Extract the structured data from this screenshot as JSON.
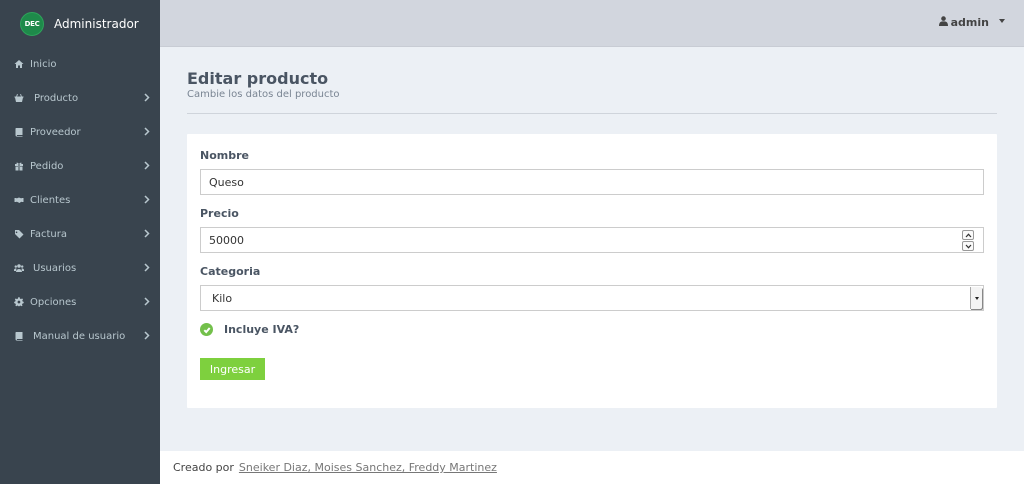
{
  "brand": {
    "logo_text": "DEC",
    "name": "Administrador"
  },
  "sidebar": {
    "items": [
      {
        "label": "Inicio",
        "icon": "home-icon",
        "has_submenu": false
      },
      {
        "label": "Producto",
        "icon": "basket-icon",
        "has_submenu": true
      },
      {
        "label": "Proveedor",
        "icon": "book-icon",
        "has_submenu": true
      },
      {
        "label": "Pedido",
        "icon": "gift-icon",
        "has_submenu": true
      },
      {
        "label": "Clientes",
        "icon": "handshake-icon",
        "has_submenu": true
      },
      {
        "label": "Factura",
        "icon": "tags-icon",
        "has_submenu": true
      },
      {
        "label": "Usuarios",
        "icon": "users-icon",
        "has_submenu": true
      },
      {
        "label": "Opciones",
        "icon": "gear-icon",
        "has_submenu": true
      },
      {
        "label": "Manual de usuario",
        "icon": "book-icon",
        "has_submenu": true
      }
    ]
  },
  "header": {
    "user_label": "admin",
    "user_icon": "user-icon"
  },
  "page": {
    "title": "Editar producto",
    "subtitle": "Cambie los datos del producto"
  },
  "form": {
    "nombre_label": "Nombre",
    "nombre_value": "Queso",
    "precio_label": "Precio",
    "precio_value": "50000",
    "categoria_label": "Categoria",
    "categoria_selected": "Kilo",
    "iva_label": "Incluye IVA?",
    "iva_checked": true,
    "submit_label": "Ingresar"
  },
  "footer": {
    "prefix": "Creado por",
    "authors": "Sneiker Diaz, Moises Sanchez, Freddy Martinez"
  },
  "colors": {
    "sidebar_bg": "#39444e",
    "header_bg": "#d2d6de",
    "accent_green": "#7ed03e",
    "check_green": "#73c04b"
  }
}
